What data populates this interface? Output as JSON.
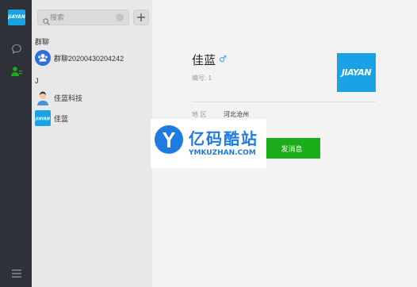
{
  "app": {
    "logo_text": "JIAYAN"
  },
  "search": {
    "placeholder": "搜索"
  },
  "add_button": "+",
  "sections": [
    {
      "header": "群聊",
      "contacts": [
        {
          "name": "群聊20200430204242",
          "avatar": "group-avatar"
        }
      ]
    },
    {
      "header": "J",
      "contacts": [
        {
          "name": "佳蓝科技",
          "avatar": "person-avatar"
        },
        {
          "name": "佳蓝",
          "avatar": "jiayan-logo-avatar"
        }
      ]
    }
  ],
  "profile": {
    "name": "佳蓝",
    "gender_symbol": "♂",
    "id_label": "编号: 1",
    "avatar_text": "JIAYAN",
    "region_label": "地 区",
    "region_value": "河北沧州",
    "send_button": "发消息"
  },
  "watermark": {
    "title": "亿码酷站",
    "url": "YMKUZHAN.COM"
  },
  "colors": {
    "accent_blue": "#1aa1e6",
    "send_green": "#1aad19",
    "rail": "#2e3238",
    "list_bg": "#e8e8e8",
    "main_bg": "#f3f3f3"
  }
}
